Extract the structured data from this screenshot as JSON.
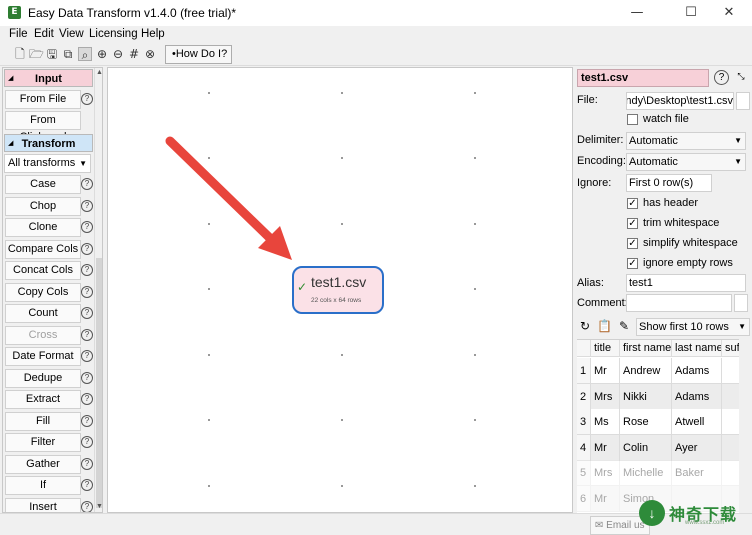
{
  "window": {
    "title": "Easy Data Transform v1.4.0 (free trial)*",
    "app_icon_letter": "E",
    "controls": [
      "—",
      "☐",
      "✕"
    ]
  },
  "menu": [
    "File",
    "Edit",
    "View",
    "Licensing",
    "Help"
  ],
  "toolbar": {
    "icons": [
      "new-file-icon",
      "open-folder-icon",
      "save-icon",
      "copy-icon",
      "search-icon",
      "zoom-in-icon",
      "zoom-out-icon",
      "grid-icon",
      "close-circle-icon"
    ],
    "how_do_i": "How Do I?"
  },
  "left_panel": {
    "input_header": "Input",
    "input_items": [
      {
        "label": "From File",
        "enabled": true
      },
      {
        "label": "From Clipboard",
        "enabled": true
      }
    ],
    "transform_header": "Transform",
    "filter_dropdown": "All transforms",
    "transform_items": [
      {
        "label": "Case",
        "enabled": true
      },
      {
        "label": "Chop",
        "enabled": true
      },
      {
        "label": "Clone",
        "enabled": true
      },
      {
        "label": "Compare Cols",
        "enabled": true
      },
      {
        "label": "Concat Cols",
        "enabled": true
      },
      {
        "label": "Copy Cols",
        "enabled": true
      },
      {
        "label": "Count",
        "enabled": true
      },
      {
        "label": "Cross",
        "enabled": false
      },
      {
        "label": "Date Format",
        "enabled": true
      },
      {
        "label": "Dedupe",
        "enabled": true
      },
      {
        "label": "Extract",
        "enabled": true
      },
      {
        "label": "Fill",
        "enabled": true
      },
      {
        "label": "Filter",
        "enabled": true
      },
      {
        "label": "Gather",
        "enabled": true
      },
      {
        "label": "If",
        "enabled": true
      },
      {
        "label": "Insert",
        "enabled": true
      }
    ],
    "help_glyph": "?"
  },
  "canvas": {
    "node": {
      "name": "test1.csv",
      "info": "22 cols x 64 rows",
      "status_glyph": "✓"
    },
    "arrow_color": "#e8453c"
  },
  "right_panel": {
    "node_name": "test1.csv",
    "help_glyph": "?",
    "file_label": "File:",
    "file_value": "andy\\Desktop\\test1.csv",
    "watch_file_label": "watch file",
    "watch_file_checked": false,
    "delimiter_label": "Delimiter:",
    "delimiter_value": "Automatic",
    "encoding_label": "Encoding:",
    "encoding_value": "Automatic",
    "ignore_label": "Ignore:",
    "ignore_value": "First 0 row(s)",
    "options": [
      {
        "label": "has header",
        "checked": true
      },
      {
        "label": "trim whitespace",
        "checked": true
      },
      {
        "label": "simplify whitespace",
        "checked": true
      },
      {
        "label": "ignore empty rows",
        "checked": true
      }
    ],
    "alias_label": "Alias:",
    "alias_value": "test1",
    "comment_label": "Comment:",
    "comment_value": "",
    "show_rows": "Show first 10 rows",
    "table": {
      "headers": [
        "",
        "title",
        "first name",
        "last name",
        "suff"
      ],
      "rows": [
        [
          "1",
          "Mr",
          "Andrew",
          "Adams"
        ],
        [
          "2",
          "Mrs",
          "Nikki",
          "Adams"
        ],
        [
          "3",
          "Ms",
          "Rose",
          "Atwell"
        ],
        [
          "4",
          "Mr",
          "Colin",
          "Ayer"
        ],
        [
          "5",
          "Mrs",
          "Michelle",
          "Baker"
        ],
        [
          "6",
          "Mr",
          "Simon",
          ""
        ]
      ]
    }
  },
  "status_bar": {
    "email_label": "Email us"
  },
  "watermark": {
    "text": "神奇下载",
    "sub": "www.ssxz.com",
    "glyph": "↓"
  }
}
